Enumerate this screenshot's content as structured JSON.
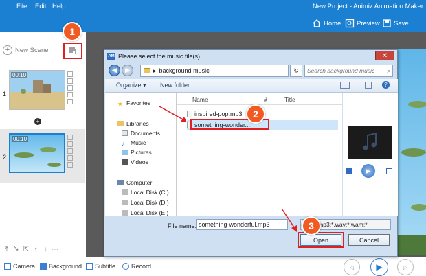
{
  "app": {
    "menu": [
      "File",
      "Edit",
      "Help"
    ],
    "title": "New Project - Animiz Animation Maker",
    "toolbar": {
      "home": "Home",
      "preview": "Preview",
      "save": "Save"
    }
  },
  "scenes": {
    "new_scene_label": "New Scene",
    "items": [
      {
        "number": "1",
        "time": "00:10"
      },
      {
        "number": "2",
        "time": "00:10"
      }
    ]
  },
  "bottom_bar": {
    "camera": "Camera",
    "background": "Background",
    "subtitle": "Subtitle",
    "record": "Record"
  },
  "dialog": {
    "title": "Please select the music file(s)",
    "path": "background music",
    "search_placeholder": "Search background music",
    "organize": "Organize ▾",
    "new_folder": "New folder",
    "nav": {
      "favorites": "Favorites",
      "libraries": "Libraries",
      "documents": "Documents",
      "music": "Music",
      "pictures": "Pictures",
      "videos": "Videos",
      "computer": "Computer",
      "disk_c": "Local Disk (C:)",
      "disk_d": "Local Disk (D:)",
      "disk_e": "Local Disk (E:)"
    },
    "columns": {
      "name": "Name",
      "number": "#",
      "title": "Title"
    },
    "files": [
      "inspired-pop.mp3",
      "something-wonder..."
    ],
    "file_name_label": "File name:",
    "file_name_value": "something-wonderful.mp3",
    "file_type": "File(*.mp3;*.wav;*.wam;*",
    "open": "Open",
    "cancel": "Cancel"
  },
  "markers": [
    "1",
    "2",
    "3"
  ],
  "colors": {
    "accent": "#1b7fd2",
    "marker": "#f15a22",
    "highlight": "#e02020"
  }
}
